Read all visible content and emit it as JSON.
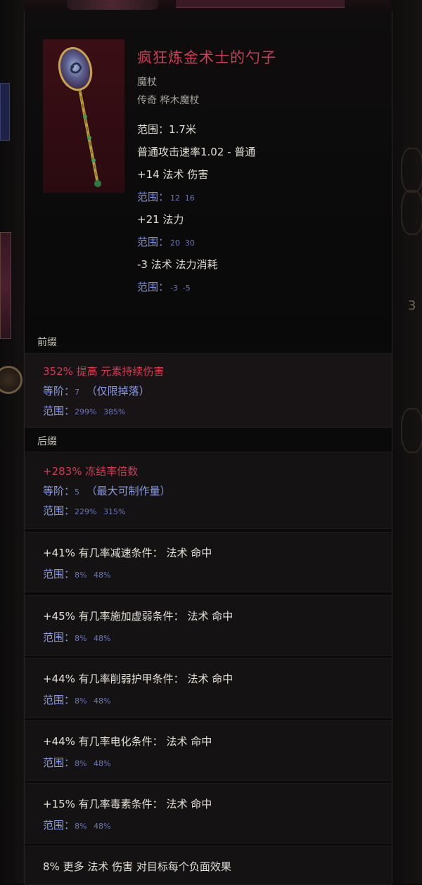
{
  "item": {
    "name": "疯狂炼金术士的勺子",
    "base_type": "魔杖",
    "rarity_line": "传奇 桦木魔杖",
    "stats": [
      {
        "text": "范围：1.7米"
      },
      {
        "text": "普通攻击速率1.02 - 普通"
      },
      {
        "text": "+14 法术 伤害",
        "range": {
          "label": "范围：",
          "min": "12",
          "max": "16"
        }
      },
      {
        "text": "+21 法力",
        "range": {
          "label": "范围：",
          "min": "20",
          "max": "30"
        }
      },
      {
        "text": "-3 法术 法力消耗",
        "range": {
          "label": "范围：",
          "min": "-3",
          "max": "-5"
        }
      }
    ]
  },
  "prefix": {
    "label": "前缀",
    "entries": [
      {
        "text": "352% 提高 元素持续伤害",
        "tier_label": "等阶：",
        "tier": "7",
        "tier_note": "（仅限掉落）",
        "range_label": "范围：",
        "range_min": "299%",
        "range_max": "385%"
      }
    ]
  },
  "suffix": {
    "label": "后缀",
    "entries": [
      {
        "text": "+283% 冻结率倍数",
        "tier_label": "等阶：",
        "tier": "5",
        "tier_note": "（最大可制作量）",
        "range_label": "范围：",
        "range_min": "229%",
        "range_max": "315%"
      },
      {
        "text": "+41% 有几率减速条件：  法术 命中",
        "range_label": "范围：",
        "range_min": "8%",
        "range_max": "48%"
      },
      {
        "text": "+45% 有几率施加虚弱条件：  法术 命中",
        "range_label": "范围：",
        "range_min": "8%",
        "range_max": "48%"
      },
      {
        "text": "+44% 有几率削弱护甲条件：  法术 命中",
        "range_label": "范围：",
        "range_min": "8%",
        "range_max": "48%"
      },
      {
        "text": "+44% 有几率电化条件：  法术 命中",
        "range_label": "范围：",
        "range_min": "8%",
        "range_max": "48%"
      },
      {
        "text": "+15% 有几率毒素条件：  法术 命中",
        "range_label": "范围：",
        "range_min": "8%",
        "range_max": "48%"
      },
      {
        "text": "8% 更多 法术 伤害 对目标每个负面效果"
      }
    ]
  },
  "background": {
    "right_digit": "3"
  },
  "colors": {
    "title": "#d23a54",
    "range": "#7d8fd9",
    "affix_red": "#d13a55"
  }
}
